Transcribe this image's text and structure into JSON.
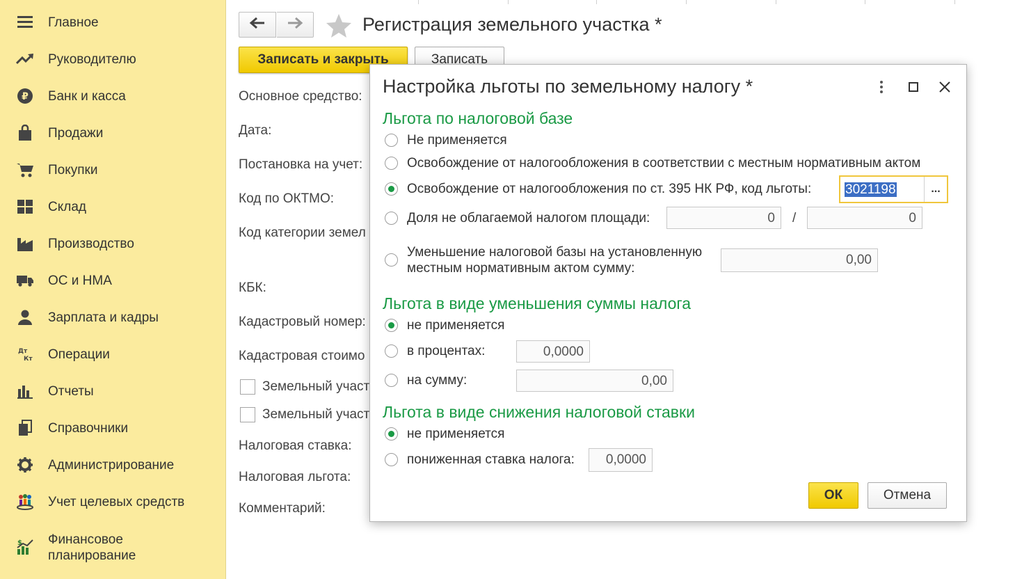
{
  "sidebar": {
    "items": [
      {
        "label": "Главное",
        "icon": "menu-icon"
      },
      {
        "label": "Руководителю",
        "icon": "trend-icon"
      },
      {
        "label": "Банк и касса",
        "icon": "ruble-icon"
      },
      {
        "label": "Продажи",
        "icon": "shopping-bag-icon"
      },
      {
        "label": "Покупки",
        "icon": "cart-icon"
      },
      {
        "label": "Склад",
        "icon": "warehouse-icon"
      },
      {
        "label": "Производство",
        "icon": "factory-icon"
      },
      {
        "label": "ОС и НМА",
        "icon": "truck-icon"
      },
      {
        "label": "Зарплата и кадры",
        "icon": "person-icon"
      },
      {
        "label": "Операции",
        "icon": "dt-kt-icon",
        "icon_text": [
          "Дт",
          "Кт"
        ]
      },
      {
        "label": "Отчеты",
        "icon": "bar-chart-icon"
      },
      {
        "label": "Справочники",
        "icon": "books-icon"
      },
      {
        "label": "Администрирование",
        "icon": "gear-icon"
      },
      {
        "label": "Учет целевых средств",
        "icon": "people-icon"
      },
      {
        "label": "Финансовое\nпланирование",
        "icon": "finance-chart-icon"
      }
    ]
  },
  "form": {
    "title": "Регистрация земельного участка *",
    "save_close": "Записать и закрыть",
    "save": "Записать",
    "labels": {
      "asset": "Основное средство:",
      "date": "Дата:",
      "registration": "Постановка на учет:",
      "oktmo": "Код по ОКТМО:",
      "category": "Код категории земел",
      "kbk": "КБК:",
      "cadastral_number": "Кадастровый номер:",
      "cadastral_value": "Кадастровая стоимо",
      "plot1": "Земельный участ",
      "plot2": "Земельный участ",
      "tax_rate": "Налоговая ставка:",
      "tax_benefit": "Налоговая льгота:",
      "comment": "Комментарий:"
    }
  },
  "dialog": {
    "title": "Настройка льготы по земельному налогу *",
    "section1": {
      "title": "Льгота по налоговой базе",
      "options": {
        "not_applied": "Не применяется",
        "local_act": "Освобождение от налогообложения в соответствии с местным нормативным актом",
        "art395": "Освобождение от налогообложения по ст. 395 НК РФ, код льготы:",
        "share": "Доля не облагаемой налогом площади:",
        "reduction": "Уменьшение налоговой базы на установленную\nместным нормативным актом сумму:"
      },
      "code_value": "3021198",
      "share_num": "0",
      "share_den": "0",
      "reduction_amount": "0,00"
    },
    "section2": {
      "title": "Льгота в виде уменьшения суммы налога",
      "options": {
        "not_applied": "не применяется",
        "percent": "в процентах:",
        "amount": "на сумму:"
      },
      "percent_value": "0,0000",
      "amount_value": "0,00"
    },
    "section3": {
      "title": "Льгота в виде снижения налоговой ставки",
      "options": {
        "not_applied": "не применяется",
        "reduced": "пониженная ставка налога:"
      },
      "rate_value": "0,0000"
    },
    "ok": "ОК",
    "cancel": "Отмена"
  },
  "colors": {
    "sidebar_bg": "#fbeb9e",
    "accent_yellow": "#f5d60a",
    "section_green": "#1a9a45",
    "selection_blue": "#3c6ec4"
  }
}
